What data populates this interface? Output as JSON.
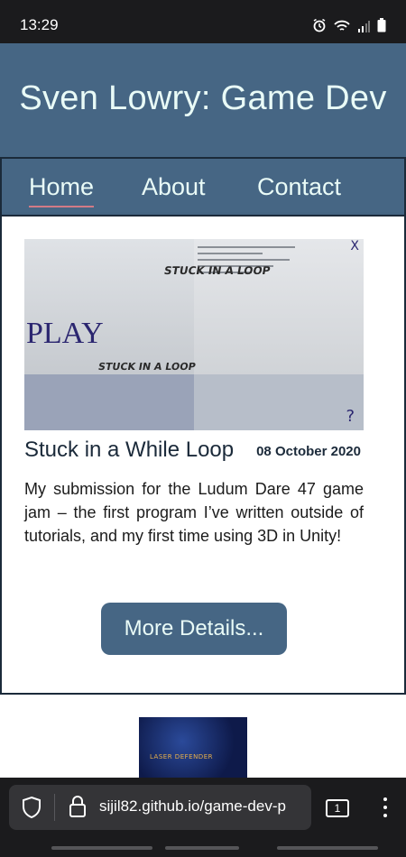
{
  "status_bar": {
    "time": "13:29",
    "icons": [
      "alarm-icon",
      "wifi-icon",
      "signal-icon",
      "battery-icon"
    ]
  },
  "site": {
    "title": "Sven Lowry: Game Dev"
  },
  "nav": {
    "items": [
      {
        "label": "Home",
        "active": true
      },
      {
        "label": "About",
        "active": false
      },
      {
        "label": "Contact",
        "active": false
      }
    ]
  },
  "post": {
    "thumbnail": {
      "play_label": "PLAY",
      "close_label": "X",
      "help_label": "?",
      "loop_text_1": "STUCK IN A LOOP",
      "loop_text_2": "STUCK IN A LOOP"
    },
    "title": "Stuck in a While Loop",
    "date": "08 October 2020",
    "description": "My submission for the Ludum Dare 47 game jam – the first program I’ve written outside of tutorials, and my first time using 3D in Unity!",
    "button_label": "More Details..."
  },
  "next_post": {
    "thumbnail_text": "LASER DEFENDER"
  },
  "browser": {
    "url": "sijil82.github.io/game-dev-p",
    "tab_count": "1"
  },
  "colors": {
    "header_bg": "#466684",
    "title_text": "#e9fbf7",
    "nav_underline": "#d27a86",
    "dark_text": "#1b2a3a"
  }
}
